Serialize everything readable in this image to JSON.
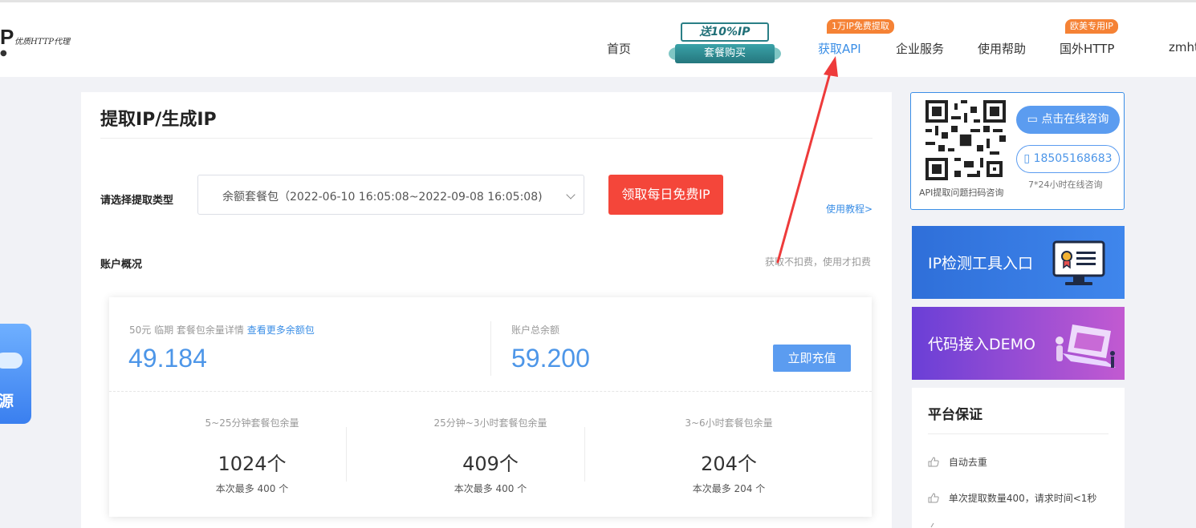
{
  "header": {
    "logo_letter": "P",
    "logo_tagline": "优质HTTP代理",
    "nav": [
      {
        "label": "首页"
      },
      {
        "label": "获取API",
        "badge": "1万IP免费提取"
      },
      {
        "label": "企业服务"
      },
      {
        "label": "使用帮助"
      },
      {
        "label": "国外HTTP",
        "badge": "欧美专用IP"
      },
      {
        "label": "zmht"
      }
    ],
    "promo": {
      "top": "送10%IP",
      "bottom": "套餐购买"
    }
  },
  "main": {
    "title": "提取IP/生成IP",
    "type_label": "请选择提取类型",
    "select_value": "余额套餐包（2022-06-10 16:05:08~2022-09-08 16:05:08)",
    "free_button": "领取每日免费IP",
    "tutorial_link": "使用教程>",
    "overview_label": "账户概况",
    "note": "获取不扣费，使用才扣费",
    "balance": {
      "package_label": "50元 临期 套餐包余量详情",
      "package_more": "查看更多余额包",
      "package_value": "49.184",
      "total_label": "账户总余额",
      "total_value": "59.200",
      "recharge_button": "立即充值"
    },
    "packages": [
      {
        "label": "5~25分钟套餐包余量",
        "count": "1024个",
        "max": "本次最多 400 个"
      },
      {
        "label": "25分钟~3小时套餐包余量",
        "count": "409个",
        "max": "本次最多 400 个"
      },
      {
        "label": "3~6小时套餐包余量",
        "count": "204个",
        "max": "本次最多 204 个"
      }
    ]
  },
  "sidebar": {
    "qr_caption": "API提取问题扫码咨询",
    "consult_button": "点击在线咨询",
    "phone": "18505168683",
    "hours": "7*24小时在线咨询",
    "banner_tools": "IP检测工具入口",
    "banner_demo": "代码接入DEMO",
    "guarantee_title": "平台保证",
    "guarantee_items": [
      "自动去重",
      "单次提取数量400，请求时间<1秒"
    ]
  },
  "float_left": {
    "label": "源"
  },
  "colors": {
    "accent": "#3a8ee6",
    "red": "#f4463a",
    "annotation": "#ee3b3b"
  }
}
